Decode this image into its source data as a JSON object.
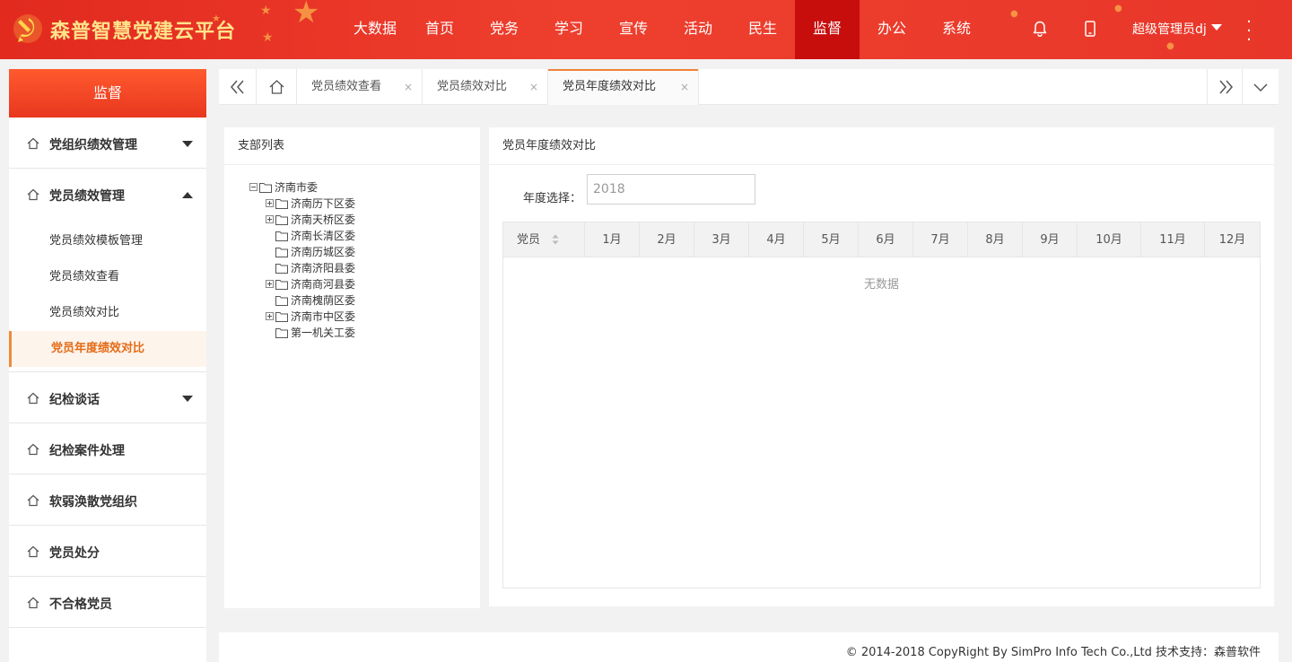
{
  "header": {
    "app_title": "森普智慧党建云平台",
    "nav": [
      "大数据",
      "首页",
      "党务",
      "学习",
      "宣传",
      "活动",
      "民生",
      "监督",
      "办公",
      "系统"
    ],
    "active_nav": "监督",
    "user_name": "超级管理员dj",
    "icons": [
      "bell-icon",
      "mobile-icon",
      "more-icon"
    ]
  },
  "sidebar": {
    "title": "监督",
    "groups": [
      {
        "label": "党组织绩效管理",
        "caret": "down"
      },
      {
        "label": "党员绩效管理",
        "caret": "up",
        "children": [
          "党员绩效模板管理",
          "党员绩效查看",
          "党员绩效对比",
          "党员年度绩效对比"
        ],
        "active_child": "党员年度绩效对比"
      },
      {
        "label": "纪检谈话",
        "caret": "down"
      },
      {
        "label": "纪检案件处理"
      },
      {
        "label": "软弱涣散党组织"
      },
      {
        "label": "党员处分"
      },
      {
        "label": "不合格党员"
      }
    ]
  },
  "tabs": {
    "items": [
      "党员绩效查看",
      "党员绩效对比",
      "党员年度绩效对比"
    ],
    "active": "党员年度绩效对比",
    "close_glyph": "×"
  },
  "branch_panel": {
    "title": "支部列表",
    "tree": {
      "root": "济南市委",
      "children": [
        {
          "label": "济南历下区委",
          "expandable": true
        },
        {
          "label": "济南天桥区委",
          "expandable": true
        },
        {
          "label": "济南长清区委",
          "expandable": false
        },
        {
          "label": "济南历城区委",
          "expandable": false
        },
        {
          "label": "济南济阳县委",
          "expandable": false
        },
        {
          "label": "济南商河县委",
          "expandable": true
        },
        {
          "label": "济南槐荫区委",
          "expandable": false
        },
        {
          "label": "济南市中区委",
          "expandable": true
        },
        {
          "label": "第一机关工委",
          "expandable": false
        }
      ]
    }
  },
  "main_panel": {
    "title": "党员年度绩效对比",
    "year_label": "年度选择：",
    "year_value": "2018",
    "table": {
      "columns": [
        "党员",
        "1月",
        "2月",
        "3月",
        "4月",
        "5月",
        "6月",
        "7月",
        "8月",
        "9月",
        "10月",
        "11月",
        "12月"
      ],
      "empty_text": "无数据"
    }
  },
  "footer": {
    "copyright": "© 2014-2018 CopyRight By SimPro Info Tech Co.,Ltd 技术支持：森普软件"
  },
  "colors": {
    "header_red": "#e8372a",
    "active_nav": "#c80d0d",
    "accent_orange": "#f0823a",
    "title_gold": "#ffe38a"
  }
}
